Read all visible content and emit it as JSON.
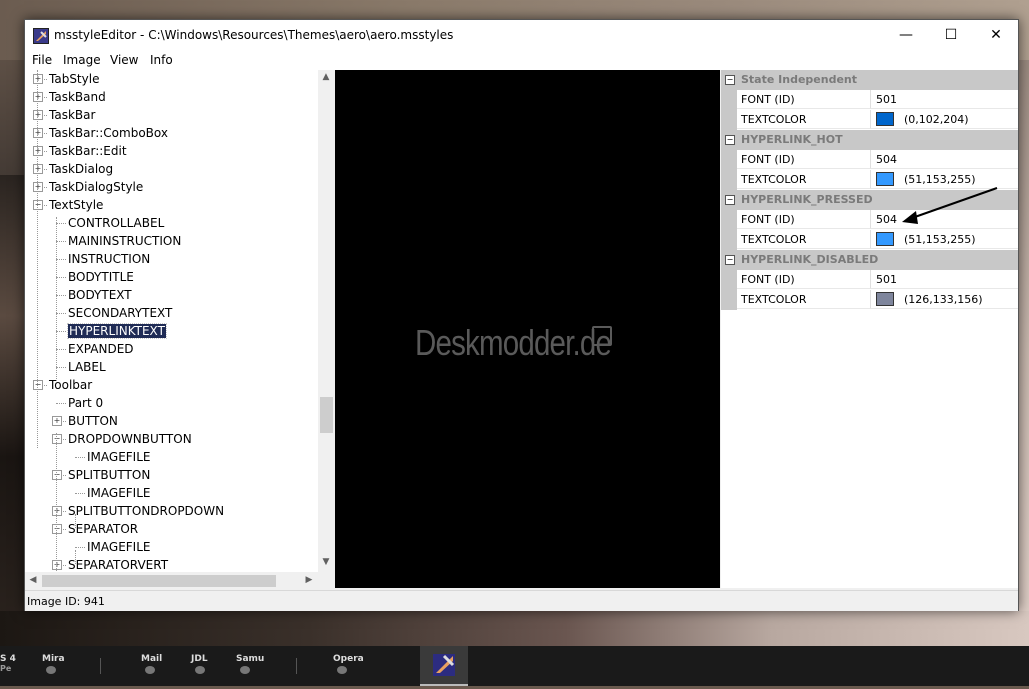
{
  "window": {
    "title": "msstyleEditor - C:\\Windows\\Resources\\Themes\\aero\\aero.msstyles",
    "buttons": {
      "minimize": "—",
      "maximize": "☐",
      "close": "✕"
    }
  },
  "menu": [
    "File",
    "Image",
    "View",
    "Info"
  ],
  "tree": {
    "items": [
      {
        "label": "TabStyle",
        "level": 0,
        "exp": "+"
      },
      {
        "label": "TaskBand",
        "level": 0,
        "exp": "+"
      },
      {
        "label": "TaskBar",
        "level": 0,
        "exp": "+"
      },
      {
        "label": "TaskBar::ComboBox",
        "level": 0,
        "exp": "+"
      },
      {
        "label": "TaskBar::Edit",
        "level": 0,
        "exp": "+"
      },
      {
        "label": "TaskDialog",
        "level": 0,
        "exp": "+"
      },
      {
        "label": "TaskDialogStyle",
        "level": 0,
        "exp": "+"
      },
      {
        "label": "TextStyle",
        "level": 0,
        "exp": "−"
      },
      {
        "label": "CONTROLLABEL",
        "level": 1,
        "exp": ""
      },
      {
        "label": "MAININSTRUCTION",
        "level": 1,
        "exp": ""
      },
      {
        "label": "INSTRUCTION",
        "level": 1,
        "exp": ""
      },
      {
        "label": "BODYTITLE",
        "level": 1,
        "exp": ""
      },
      {
        "label": "BODYTEXT",
        "level": 1,
        "exp": ""
      },
      {
        "label": "SECONDARYTEXT",
        "level": 1,
        "exp": ""
      },
      {
        "label": "HYPERLINKTEXT",
        "level": 1,
        "exp": "",
        "selected": true
      },
      {
        "label": "EXPANDED",
        "level": 1,
        "exp": ""
      },
      {
        "label": "LABEL",
        "level": 1,
        "exp": ""
      },
      {
        "label": "Toolbar",
        "level": 0,
        "exp": "−"
      },
      {
        "label": "Part 0",
        "level": 1,
        "exp": ""
      },
      {
        "label": "BUTTON",
        "level": 1,
        "exp": "+"
      },
      {
        "label": "DROPDOWNBUTTON",
        "level": 1,
        "exp": "−"
      },
      {
        "label": "IMAGEFILE",
        "level": 2,
        "exp": ""
      },
      {
        "label": "SPLITBUTTON",
        "level": 1,
        "exp": "−"
      },
      {
        "label": "IMAGEFILE",
        "level": 2,
        "exp": ""
      },
      {
        "label": "SPLITBUTTONDROPDOWN",
        "level": 1,
        "exp": "+"
      },
      {
        "label": "SEPARATOR",
        "level": 1,
        "exp": "−"
      },
      {
        "label": "IMAGEFILE",
        "level": 2,
        "exp": ""
      },
      {
        "label": "SEPARATORVERT",
        "level": 1,
        "exp": "+"
      }
    ]
  },
  "preview": {
    "watermark": "Deskmodder.de"
  },
  "properties": {
    "groups": [
      {
        "name": "State Independent",
        "rows": [
          {
            "name": "FONT (ID)",
            "value": "501"
          },
          {
            "name": "TEXTCOLOR",
            "value": "(0,102,204)",
            "color": "#0066cc"
          }
        ]
      },
      {
        "name": "HYPERLINK_HOT",
        "rows": [
          {
            "name": "FONT (ID)",
            "value": "504"
          },
          {
            "name": "TEXTCOLOR",
            "value": "(51,153,255)",
            "color": "#3399ff"
          }
        ]
      },
      {
        "name": "HYPERLINK_PRESSED",
        "rows": [
          {
            "name": "FONT (ID)",
            "value": "504"
          },
          {
            "name": "TEXTCOLOR",
            "value": "(51,153,255)",
            "color": "#3399ff"
          }
        ]
      },
      {
        "name": "HYPERLINK_DISABLED",
        "rows": [
          {
            "name": "FONT (ID)",
            "value": "501"
          },
          {
            "name": "TEXTCOLOR",
            "value": "(126,133,156)",
            "color": "#7e859c"
          }
        ]
      }
    ]
  },
  "status": {
    "text": "Image ID: 941"
  },
  "taskbar": {
    "items": [
      {
        "label": "S 4",
        "sub": "Pe"
      },
      {
        "label": "Mira",
        "sub": ""
      },
      {
        "label": "Mail",
        "sub": ""
      },
      {
        "label": "JDL",
        "sub": ""
      },
      {
        "label": "Samu",
        "sub": ""
      },
      {
        "label": "Opera",
        "sub": ""
      }
    ]
  }
}
